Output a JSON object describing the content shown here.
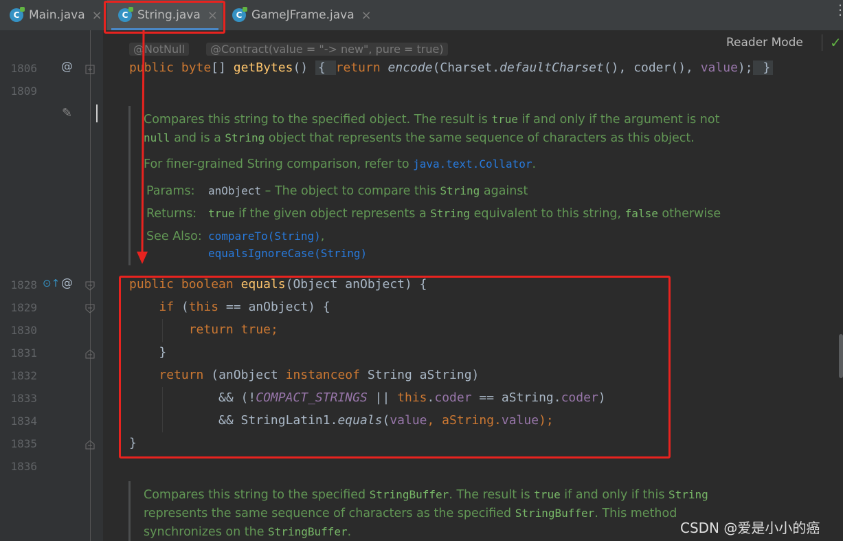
{
  "tabs": [
    {
      "label": "Main.java",
      "close": "×"
    },
    {
      "label": "String.java",
      "close": "×"
    },
    {
      "label": "GameJFrame.java",
      "close": "×"
    }
  ],
  "file_icon_letter": "C",
  "more_icon": "⋮",
  "reader_mode": "Reader Mode",
  "check_icon": "✓",
  "inlay": {
    "notnull": "@NotNull",
    "contract": "@Contract(value = \"-> new\", pure = true)"
  },
  "gutter": {
    "at_icon": "@",
    "override_icon": "⊙↑",
    "edit_icon": "✎",
    "lines": [
      "1806",
      "1809",
      "1828",
      "1829",
      "1830",
      "1831",
      "1832",
      "1833",
      "1834",
      "1835",
      "1836"
    ]
  },
  "code": {
    "l1806": {
      "kw1": "public",
      "t1": "byte",
      "t2": "[] ",
      "m": "getBytes",
      "t3": "() ",
      "c1": "{ ",
      "kw2": "return",
      "t4": " ",
      "m2": "encode",
      "t5": "(Charset.",
      "m3": "defaultCharset",
      "t6": "(), coder(), ",
      "f1": "value",
      "t7": ");",
      "c2": " }"
    },
    "l1828": {
      "kw1": "public",
      "kw2": "boolean",
      "m": "equals",
      "t": "(Object anObject) {"
    },
    "l1829": {
      "kw": "if",
      "t1": " (",
      "kw2": "this",
      "t2": " == anObject) {"
    },
    "l1830": {
      "kw": "return",
      "kw2": "true",
      "t": ";"
    },
    "l1831": {
      "t": "}"
    },
    "l1832": {
      "kw": "return",
      "t1": " (anObject ",
      "kw2": "instanceof",
      "t2": " String aString)"
    },
    "l1833": {
      "t1": "&& (!",
      "c": "COMPACT_STRINGS",
      "t2": " || ",
      "kw": "this",
      "t3": ".",
      "f1": "coder",
      "t4": " == aString.",
      "f2": "coder",
      "t5": ")"
    },
    "l1834": {
      "t1": "&& StringLatin1.",
      "m": "equals",
      "t2": "(",
      "f1": "value",
      "t3": ", aString.",
      "f2": "value",
      "t4": ");"
    },
    "l1835": {
      "t": "}"
    }
  },
  "doc1": {
    "p1a": "Compares this string to the specified object. The result is ",
    "p1b": "true",
    "p1c": " if and only if the argument is not",
    "p2a": "null",
    "p2b": " and is a ",
    "p2c": "String",
    "p2d": " object that represents the same sequence of characters as this object.",
    "p3a": "For finer-grained String comparison, refer to ",
    "p3b": "java.text.Collator",
    "p3c": ".",
    "params_label": "Params:",
    "params_name": "anObject",
    "params_a": " – The object to compare this ",
    "params_b": "String",
    "params_c": " against",
    "returns_label": "Returns:",
    "returns_a": "true",
    "returns_b": " if the given object represents a ",
    "returns_c": "String",
    "returns_d": " equivalent to this string, ",
    "returns_e": "false",
    "returns_f": " otherwise",
    "see_label": "See Also:",
    "see_1": "compareTo(String)",
    "see_1b": ",",
    "see_2": "equalsIgnoreCase(String)"
  },
  "doc2": {
    "l1a": "Compares this string to the specified ",
    "l1b": "StringBuffer",
    "l1c": ". The result is ",
    "l1d": "true",
    "l1e": " if and only if this ",
    "l1f": "String",
    "l2a": "represents the same sequence of characters as the specified ",
    "l2b": "StringBuffer",
    "l2c": ". This method",
    "l3a": "synchronizes on the ",
    "l3b": "StringBuffer",
    "l3c": "."
  },
  "watermark": "CSDN @爱是小小的癌",
  "colors": {
    "keyword": "#cc7832",
    "method": "#ffc66d",
    "field": "#9876aa",
    "doc": "#629755",
    "link": "#287bde",
    "annotation_red": "#e8231f"
  }
}
